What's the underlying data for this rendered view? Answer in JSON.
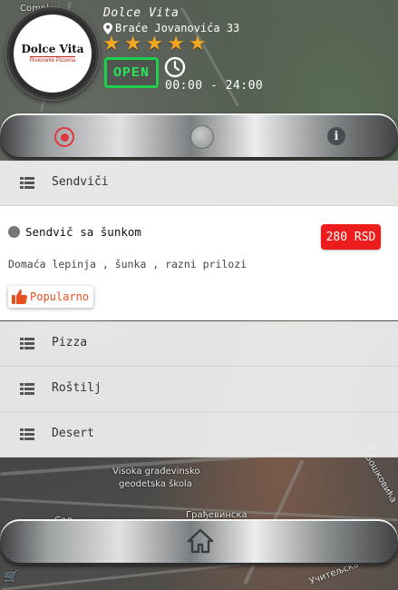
{
  "header": {
    "logo": {
      "name": "Dolce Vita",
      "subtitle": "Ristorante Pizzeria"
    },
    "restaurant_name": "Dolce Vita",
    "address": "Braće Jovanovića 33",
    "rating": 5,
    "status": "OPEN",
    "hours": "00:00 - 24:00"
  },
  "nav_top": {
    "icons": [
      "record-icon",
      "circle-button-icon",
      "info-icon"
    ]
  },
  "menu": {
    "categories": [
      {
        "label": "Sendviči"
      },
      {
        "label": "Pizza"
      },
      {
        "label": "Roštilj"
      },
      {
        "label": "Desert"
      }
    ],
    "item": {
      "name": "Sendvič sa šunkom",
      "price": "280 RSD",
      "description": "Domaća lepinja , šunka , razni prilozi",
      "tag": "Popularno"
    }
  },
  "map_labels": {
    "school_1": "Visoka građevinsko",
    "school_2": "geodetska škola",
    "street_1": "Грађевинска",
    "street_2": "Учитељска",
    "street_3": "Бошковића",
    "misc_1": "Сел",
    "misc_2": "Complex"
  },
  "colors": {
    "accent_red": "#ee1d1d",
    "open_green": "#1dd04a",
    "star_gold": "#f2a722",
    "popular_orange": "#e8501f"
  }
}
